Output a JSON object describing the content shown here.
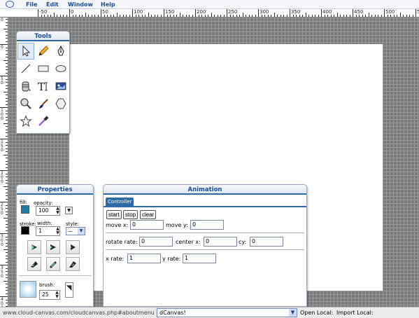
{
  "menubar": {
    "items": [
      "File",
      "Edit",
      "Window",
      "Help"
    ]
  },
  "ruler": {
    "top_labels": [
      "-50",
      "0",
      "50",
      "100",
      "150",
      "200",
      "250",
      "300",
      "350",
      "400",
      "450",
      "500",
      "550",
      "600"
    ],
    "left_labels": [
      "50",
      "0",
      "50",
      "100",
      "150",
      "200",
      "250",
      "300",
      "350",
      "400"
    ]
  },
  "tools_panel": {
    "title": "Tools",
    "tools": [
      "select",
      "pencil",
      "pen",
      "line",
      "rectangle",
      "ellipse",
      "paint-bucket",
      "text",
      "image",
      "zoom",
      "brush",
      "polygon",
      "star",
      "eyedropper"
    ]
  },
  "properties_panel": {
    "title": "Properties",
    "fill_label": "fill:",
    "opacity_label": "opacity:",
    "opacity_value": "100",
    "stroke_label": "stroke:",
    "width_label": "width:",
    "width_value": "1",
    "style_label": "style:",
    "style_value": "—",
    "brush_label": "brush:",
    "brush_value": "25",
    "fill_color": "#1f7aa8",
    "stroke_color": "#000000"
  },
  "animation_panel": {
    "title": "Animation",
    "tab_label": "Controller",
    "start_label": "start",
    "stop_label": "stop",
    "clear_label": "clear",
    "move_x_label": "move x:",
    "move_x_value": "0",
    "move_y_label": "move y:",
    "move_y_value": "0",
    "rotate_rate_label": "rotate rate:",
    "rotate_rate_value": "0",
    "center_x_label": "center x:",
    "center_x_value": "0",
    "cy_label": "cy:",
    "cy_value": "0",
    "x_rate_label": "x rate:",
    "x_rate_value": "1",
    "y_rate_label": "y rate:",
    "y_rate_value": "1"
  },
  "bottom_bar": {
    "status_url": "www.cloud-canvas.com/cloudcanvas.php#aboutmenu",
    "document_select_value": "dCanvas!",
    "open_local_label": "Open Local:",
    "import_local_label": "Import Local:"
  },
  "colors": {
    "accent": "#2d6aa6",
    "menu_text": "#1a4d96",
    "workspace": "#7a7a7a"
  }
}
